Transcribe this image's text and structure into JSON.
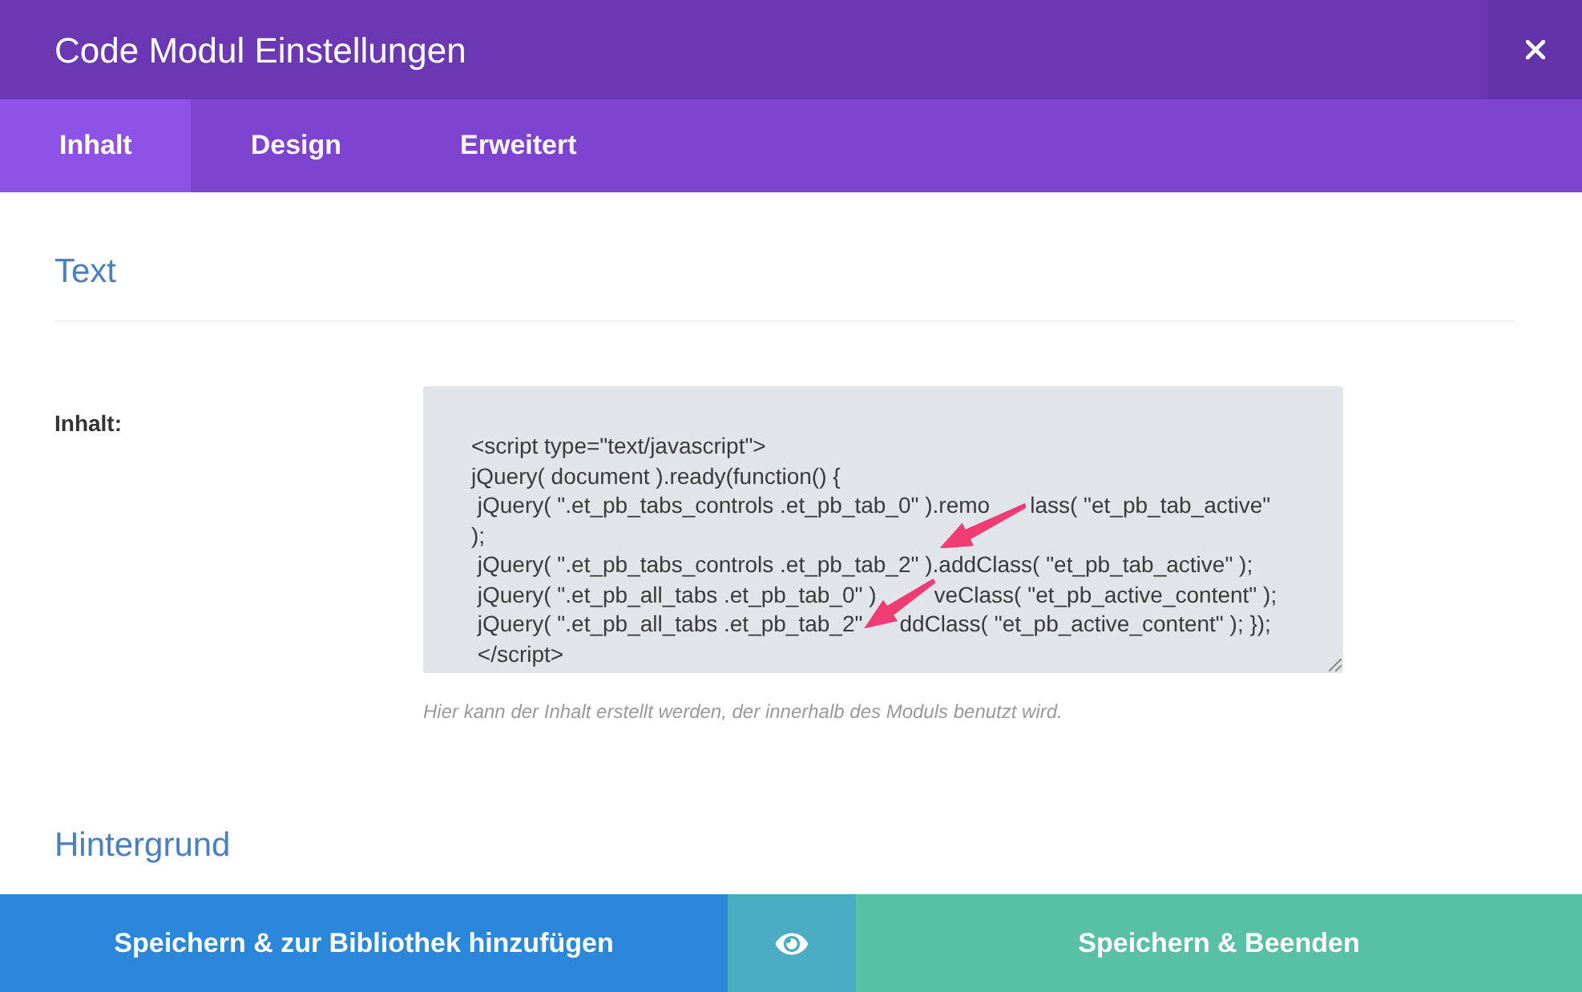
{
  "dialog": {
    "title": "Code Modul Einstellungen"
  },
  "tabs": [
    {
      "label": "Inhalt",
      "selected": true
    },
    {
      "label": "Design",
      "selected": false
    },
    {
      "label": "Erweitert",
      "selected": false
    }
  ],
  "sections": [
    {
      "title": "Text",
      "fields": [
        {
          "label": "Inhalt:",
          "lines": [
            [
              "<script type=\"text/javascript\">"
            ],
            [
              "jQuery( document ).ready(function() {"
            ],
            [
              " jQuery( \".et_pb_tabs_controls .et_pb_tab_0\" ).remo",
              "lass( \"et_pb_tab_active\""
            ],
            [
              ");"
            ],
            [
              " jQuery( \".et_pb_tabs_controls .et_pb_tab_2\" ).addClass( \"et_pb_tab_active\" );"
            ],
            [
              " jQuery( \".et_pb_all_tabs .et_pb_tab_0\" )",
              "veClass( \"et_pb_active_content\" );"
            ],
            [
              " jQuery( \".et_pb_all_tabs .et_pb_tab_2\"",
              "ddClass( \"et_pb_active_content\" ); });"
            ],
            [
              " </script>"
            ]
          ],
          "help": "Hier kann der Inhalt erstellt werden, der innerhalb des Moduls benutzt wird."
        }
      ]
    },
    {
      "title": "Hintergrund"
    }
  ],
  "footer": {
    "buttons": [
      {
        "kind": "library",
        "label": "Speichern & zur Bibliothek hinzufügen"
      },
      {
        "kind": "preview"
      },
      {
        "kind": "save",
        "label": "Speichern & Beenden"
      }
    ]
  }
}
